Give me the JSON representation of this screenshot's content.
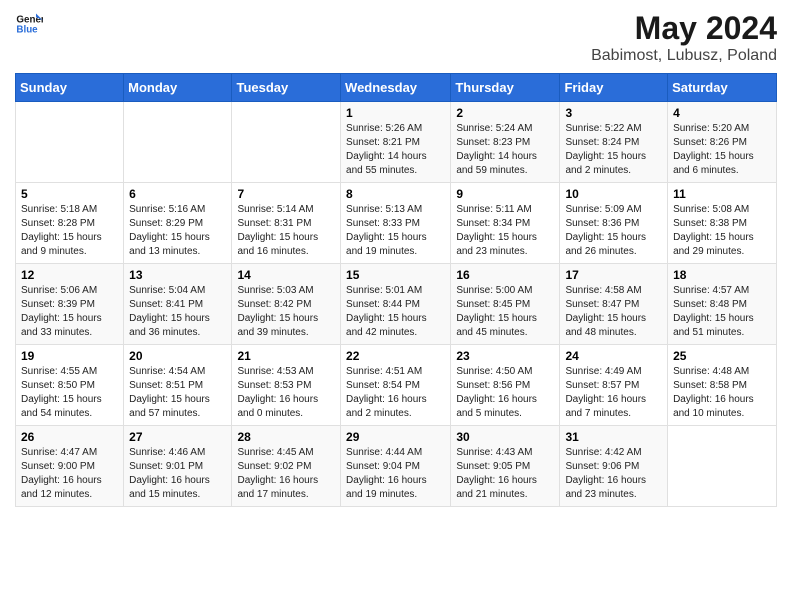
{
  "header": {
    "logo_line1": "General",
    "logo_line2": "Blue",
    "title": "May 2024",
    "subtitle": "Babimost, Lubusz, Poland"
  },
  "days_of_week": [
    "Sunday",
    "Monday",
    "Tuesday",
    "Wednesday",
    "Thursday",
    "Friday",
    "Saturday"
  ],
  "weeks": [
    [
      {
        "day": "",
        "info": ""
      },
      {
        "day": "",
        "info": ""
      },
      {
        "day": "",
        "info": ""
      },
      {
        "day": "1",
        "info": "Sunrise: 5:26 AM\nSunset: 8:21 PM\nDaylight: 14 hours\nand 55 minutes."
      },
      {
        "day": "2",
        "info": "Sunrise: 5:24 AM\nSunset: 8:23 PM\nDaylight: 14 hours\nand 59 minutes."
      },
      {
        "day": "3",
        "info": "Sunrise: 5:22 AM\nSunset: 8:24 PM\nDaylight: 15 hours\nand 2 minutes."
      },
      {
        "day": "4",
        "info": "Sunrise: 5:20 AM\nSunset: 8:26 PM\nDaylight: 15 hours\nand 6 minutes."
      }
    ],
    [
      {
        "day": "5",
        "info": "Sunrise: 5:18 AM\nSunset: 8:28 PM\nDaylight: 15 hours\nand 9 minutes."
      },
      {
        "day": "6",
        "info": "Sunrise: 5:16 AM\nSunset: 8:29 PM\nDaylight: 15 hours\nand 13 minutes."
      },
      {
        "day": "7",
        "info": "Sunrise: 5:14 AM\nSunset: 8:31 PM\nDaylight: 15 hours\nand 16 minutes."
      },
      {
        "day": "8",
        "info": "Sunrise: 5:13 AM\nSunset: 8:33 PM\nDaylight: 15 hours\nand 19 minutes."
      },
      {
        "day": "9",
        "info": "Sunrise: 5:11 AM\nSunset: 8:34 PM\nDaylight: 15 hours\nand 23 minutes."
      },
      {
        "day": "10",
        "info": "Sunrise: 5:09 AM\nSunset: 8:36 PM\nDaylight: 15 hours\nand 26 minutes."
      },
      {
        "day": "11",
        "info": "Sunrise: 5:08 AM\nSunset: 8:38 PM\nDaylight: 15 hours\nand 29 minutes."
      }
    ],
    [
      {
        "day": "12",
        "info": "Sunrise: 5:06 AM\nSunset: 8:39 PM\nDaylight: 15 hours\nand 33 minutes."
      },
      {
        "day": "13",
        "info": "Sunrise: 5:04 AM\nSunset: 8:41 PM\nDaylight: 15 hours\nand 36 minutes."
      },
      {
        "day": "14",
        "info": "Sunrise: 5:03 AM\nSunset: 8:42 PM\nDaylight: 15 hours\nand 39 minutes."
      },
      {
        "day": "15",
        "info": "Sunrise: 5:01 AM\nSunset: 8:44 PM\nDaylight: 15 hours\nand 42 minutes."
      },
      {
        "day": "16",
        "info": "Sunrise: 5:00 AM\nSunset: 8:45 PM\nDaylight: 15 hours\nand 45 minutes."
      },
      {
        "day": "17",
        "info": "Sunrise: 4:58 AM\nSunset: 8:47 PM\nDaylight: 15 hours\nand 48 minutes."
      },
      {
        "day": "18",
        "info": "Sunrise: 4:57 AM\nSunset: 8:48 PM\nDaylight: 15 hours\nand 51 minutes."
      }
    ],
    [
      {
        "day": "19",
        "info": "Sunrise: 4:55 AM\nSunset: 8:50 PM\nDaylight: 15 hours\nand 54 minutes."
      },
      {
        "day": "20",
        "info": "Sunrise: 4:54 AM\nSunset: 8:51 PM\nDaylight: 15 hours\nand 57 minutes."
      },
      {
        "day": "21",
        "info": "Sunrise: 4:53 AM\nSunset: 8:53 PM\nDaylight: 16 hours\nand 0 minutes."
      },
      {
        "day": "22",
        "info": "Sunrise: 4:51 AM\nSunset: 8:54 PM\nDaylight: 16 hours\nand 2 minutes."
      },
      {
        "day": "23",
        "info": "Sunrise: 4:50 AM\nSunset: 8:56 PM\nDaylight: 16 hours\nand 5 minutes."
      },
      {
        "day": "24",
        "info": "Sunrise: 4:49 AM\nSunset: 8:57 PM\nDaylight: 16 hours\nand 7 minutes."
      },
      {
        "day": "25",
        "info": "Sunrise: 4:48 AM\nSunset: 8:58 PM\nDaylight: 16 hours\nand 10 minutes."
      }
    ],
    [
      {
        "day": "26",
        "info": "Sunrise: 4:47 AM\nSunset: 9:00 PM\nDaylight: 16 hours\nand 12 minutes."
      },
      {
        "day": "27",
        "info": "Sunrise: 4:46 AM\nSunset: 9:01 PM\nDaylight: 16 hours\nand 15 minutes."
      },
      {
        "day": "28",
        "info": "Sunrise: 4:45 AM\nSunset: 9:02 PM\nDaylight: 16 hours\nand 17 minutes."
      },
      {
        "day": "29",
        "info": "Sunrise: 4:44 AM\nSunset: 9:04 PM\nDaylight: 16 hours\nand 19 minutes."
      },
      {
        "day": "30",
        "info": "Sunrise: 4:43 AM\nSunset: 9:05 PM\nDaylight: 16 hours\nand 21 minutes."
      },
      {
        "day": "31",
        "info": "Sunrise: 4:42 AM\nSunset: 9:06 PM\nDaylight: 16 hours\nand 23 minutes."
      },
      {
        "day": "",
        "info": ""
      }
    ]
  ]
}
